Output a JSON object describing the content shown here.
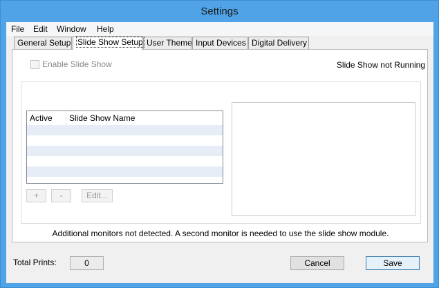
{
  "window": {
    "title": "Settings"
  },
  "menu": [
    "File",
    "Edit",
    "Window",
    "Help"
  ],
  "tabs": [
    {
      "label": "General Setup",
      "active": false
    },
    {
      "label": "Slide Show Setup",
      "active": true
    },
    {
      "label": "User Theme",
      "active": false
    },
    {
      "label": "Input Devices",
      "active": false
    },
    {
      "label": "Digital Delivery",
      "active": false
    }
  ],
  "slideshow": {
    "enable_label": "Enable Slide Show",
    "enable_checked": false,
    "status": "Slide Show not Running",
    "columns": [
      "Active",
      "Slide Show Name"
    ],
    "rows": [],
    "add_label": "+",
    "remove_label": "-",
    "edit_label": "Edit...",
    "notice": "Additional monitors not detected. A second monitor is needed to use the slide show module."
  },
  "footer": {
    "total_label": "Total Prints:",
    "total_value": "0",
    "cancel_label": "Cancel",
    "save_label": "Save"
  },
  "colors": {
    "titlebar": "#4fa3e6",
    "list_stripe": "#e6edf6",
    "primary_border": "#3c7fb1"
  }
}
